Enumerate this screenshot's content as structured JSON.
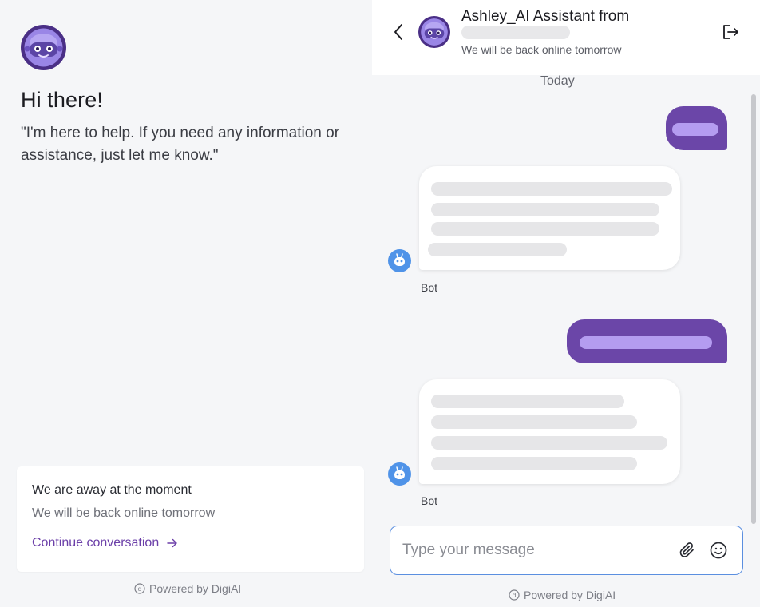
{
  "welcome": {
    "greeting": "Hi there!",
    "intro": "\"I'm here to help. If you need any information or assistance, just let me know.\"",
    "away_card": {
      "title": "We are away at the moment",
      "subtitle": "We will be back online tomorrow",
      "continue_label": "Continue conversation",
      "continue_icon": "arrow-right-icon"
    },
    "powered_by": "Powered by DigiAI"
  },
  "chat": {
    "header": {
      "title": "Ashley_AI Assistant from",
      "status": "We will be back online tomorrow",
      "back_icon": "chevron-left-icon",
      "exit_icon": "exit-icon"
    },
    "date_separator": "Today",
    "messages": [
      {
        "sender": "user",
        "content": "redacted"
      },
      {
        "sender": "bot",
        "label": "Bot",
        "content": "redacted"
      },
      {
        "sender": "user",
        "content": "redacted"
      },
      {
        "sender": "bot",
        "label": "Bot",
        "content": "redacted"
      }
    ],
    "composer": {
      "placeholder": "Type your message",
      "attach_icon": "paperclip-icon",
      "emoji_icon": "emoji-icon"
    },
    "powered_by": "Powered by DigiAI"
  },
  "colors": {
    "brand_purple": "#6b46a8",
    "user_bubble_bar": "#b49cf0",
    "composer_border": "#5b8fe0",
    "bot_icon_blue": "#4f93e8",
    "panel_bg": "#f5f6f8"
  }
}
